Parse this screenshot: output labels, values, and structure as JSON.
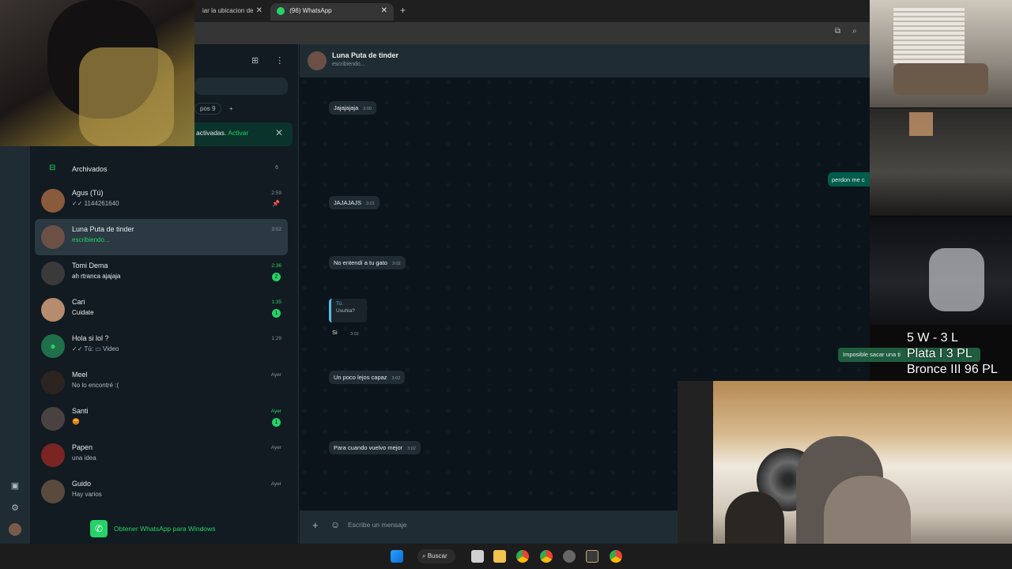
{
  "browser": {
    "tabs": [
      {
        "label": "iar la ubicacion de"
      },
      {
        "label": "(96) WhatsApp"
      }
    ],
    "tab_close": "✕",
    "new_tab": "+"
  },
  "sidebar": {
    "filters": [
      "pos 9",
      "+"
    ],
    "notification": {
      "text": "activadas.",
      "link": "Activar",
      "close": "✕"
    },
    "archived": {
      "label": "Archivados",
      "count": "6"
    },
    "chats": [
      {
        "name": "Agus (Tú)",
        "msg": "✓✓ 1144261640",
        "time": "2:59",
        "pinned": true
      },
      {
        "name": "Luna Puta de tinder",
        "msg": "escribiendo...",
        "time": "3:02",
        "selected": true,
        "typing": true
      },
      {
        "name": "Tomi Dema",
        "msg": "ah rtranca ajajaja",
        "time": "2:36",
        "badge": "2"
      },
      {
        "name": "Cari",
        "msg": "Cuidate",
        "time": "1:35",
        "badge": "1"
      },
      {
        "name": "Hola si lol ?",
        "msg": "✓✓ Tú: ▭ Video",
        "time": "1:29"
      },
      {
        "name": "Meel",
        "msg": "No lo encontré :(",
        "time": "Ayer"
      },
      {
        "name": "Santi",
        "msg": "😡",
        "time": "Ayer",
        "badge": "1"
      },
      {
        "name": "Papen",
        "msg": "una idea",
        "time": "Ayer"
      },
      {
        "name": "Guido",
        "msg": "Hay varios",
        "time": "Ayer"
      }
    ],
    "get_windows": "Obtener WhatsApp para Windows"
  },
  "conversation": {
    "name": "Luna Puta de tinder",
    "status": "escribiendo...",
    "messages": [
      {
        "text": "Jajajajaja",
        "time": "3:00"
      },
      {
        "text": "JAJAJAJS",
        "time": "3:01"
      },
      {
        "text": "No entendí a tu gato",
        "time": "3:02"
      },
      {
        "text": "Un poco lejos capaz",
        "time": "3:02"
      },
      {
        "text": "Para cuando vuelvo mejor",
        "time": "3:02"
      }
    ],
    "outgoing_partial": "perdon me c",
    "reply": {
      "quote_author": "Tú",
      "quote_text": "Usuhia?",
      "text": "Si",
      "time": "3:02"
    },
    "composer_placeholder": "Escribe un mensaje"
  },
  "overlay": {
    "rank_lines": [
      "5 W - 3 L",
      "Plata I 3 PL",
      "Bronce III 96 PL"
    ],
    "toast": "Imposible sacar una ti"
  },
  "taskbar": {
    "search_label": "Buscar"
  }
}
